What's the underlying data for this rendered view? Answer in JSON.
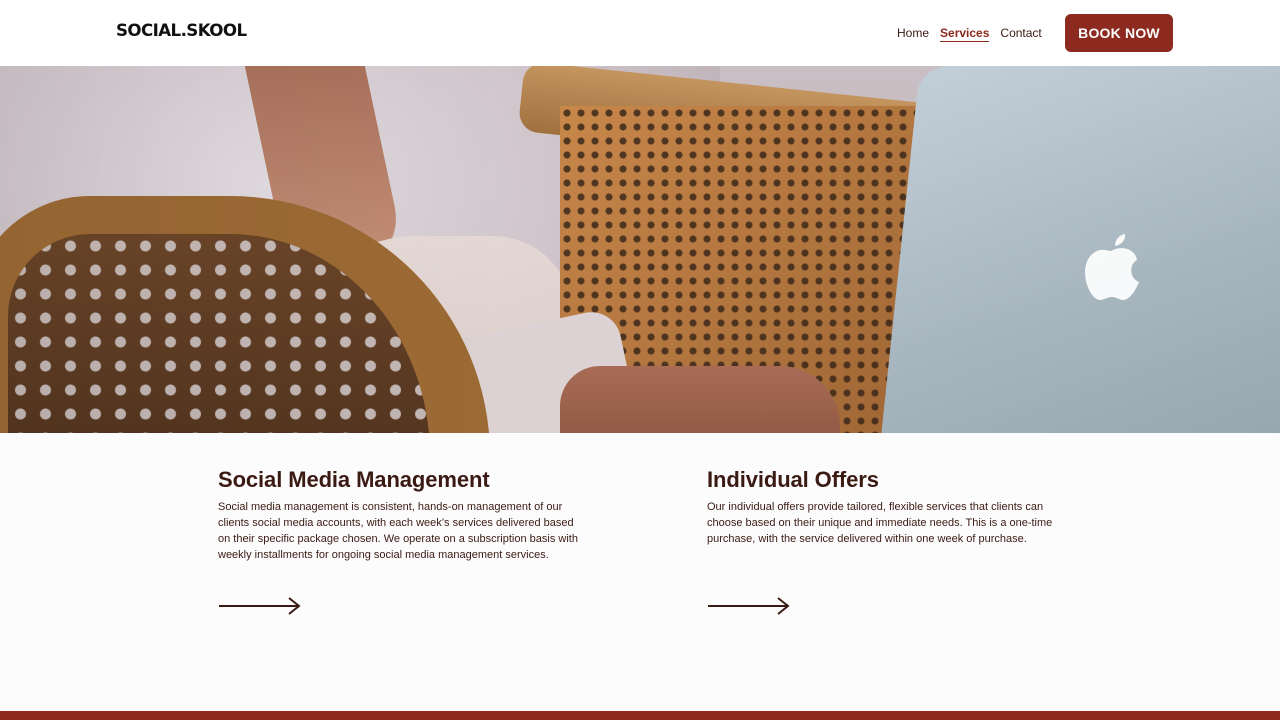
{
  "header": {
    "logo": "SOCIAL.SKOOL",
    "nav": [
      {
        "label": "Home",
        "active": false
      },
      {
        "label": "Services",
        "active": true
      },
      {
        "label": "Contact",
        "active": false
      }
    ],
    "cta_label": "BOOK NOW"
  },
  "hero": {
    "icons": [
      "apple-logo-icon"
    ]
  },
  "services": [
    {
      "title": "Social Media Management",
      "description": "Social media management is consistent, hands-on management of our clients social media accounts, with each week’s services delivered based on their specific package chosen. We operate on a subscription basis with weekly installments for ongoing social media management services.",
      "icon": "arrow-right-icon"
    },
    {
      "title": "Individual Offers",
      "description": "Our individual offers provide tailored, flexible services that clients can choose based on their unique and immediate needs. This is a one-time purchase, with the service delivered within one week of purchase.",
      "icon": "arrow-right-icon"
    }
  ],
  "colors": {
    "brand": "#8c2a1f",
    "text": "#3b1a14",
    "background": "#fdfcfc"
  }
}
